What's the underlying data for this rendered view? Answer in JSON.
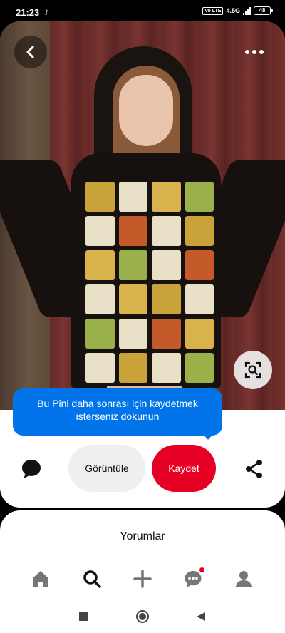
{
  "status_bar": {
    "time": "21:23",
    "network": "4.5G",
    "volte": "Vo LTE",
    "battery": "48"
  },
  "pin": {
    "image_description_icon": "crochet-granny-square-coat-photo",
    "tooltip_text": "Bu Pini daha sonrası için kaydetmek isterseniz dokunun",
    "view_button_label": "Görüntüle",
    "save_button_label": "Kaydet"
  },
  "comments": {
    "title": "Yorumlar"
  },
  "nav": {
    "items": [
      {
        "icon": "home-icon"
      },
      {
        "icon": "search-icon"
      },
      {
        "icon": "plus-icon"
      },
      {
        "icon": "messages-icon"
      },
      {
        "icon": "profile-icon"
      }
    ]
  },
  "colors": {
    "accent_red": "#e60023",
    "tooltip_blue": "#0074e8",
    "view_button_gray": "#efefef"
  }
}
